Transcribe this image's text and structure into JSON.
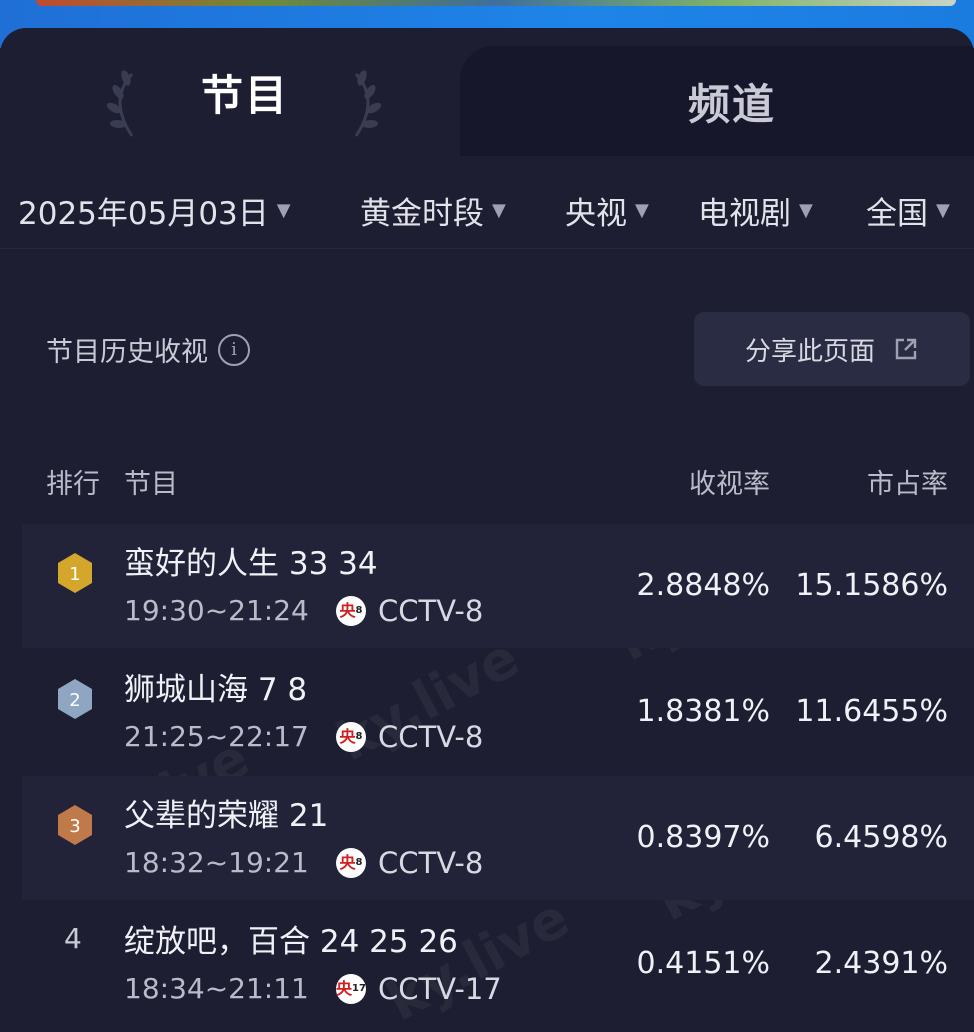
{
  "tabs": {
    "program": "节目",
    "channel": "频道"
  },
  "filters": {
    "date": "2025年05月03日",
    "timeslot": "黄金时段",
    "network": "央视",
    "genre": "电视剧",
    "region": "全国"
  },
  "section": {
    "title": "节目历史收视",
    "share_label": "分享此页面"
  },
  "table": {
    "headers": {
      "rank": "排行",
      "program": "节目",
      "rating": "收视率",
      "share": "市占率"
    },
    "rows": [
      {
        "rank": "1",
        "name": "蛮好的人生 33 34",
        "time": "19:30~21:24",
        "logo_num": "8",
        "channel": "CCTV-8",
        "rating": "2.8848%",
        "share": "15.1586%"
      },
      {
        "rank": "2",
        "name": "狮城山海 7 8",
        "time": "21:25~22:17",
        "logo_num": "8",
        "channel": "CCTV-8",
        "rating": "1.8381%",
        "share": "11.6455%"
      },
      {
        "rank": "3",
        "name": "父辈的荣耀 21",
        "time": "18:32~19:21",
        "logo_num": "8",
        "channel": "CCTV-8",
        "rating": "0.8397%",
        "share": "6.4598%"
      },
      {
        "rank": "4",
        "name": "绽放吧，百合 24 25 26",
        "time": "18:34~21:11",
        "logo_num": "17",
        "channel": "CCTV-17",
        "rating": "0.4151%",
        "share": "2.4391%"
      }
    ]
  },
  "logo_char": "央",
  "watermark": "ky.live",
  "colors": {
    "gold": "#d4a72c",
    "silver": "#8fa6c2",
    "bronze": "#c07a4a",
    "banner": "#1e84e8",
    "panel": "#1d1e31"
  }
}
